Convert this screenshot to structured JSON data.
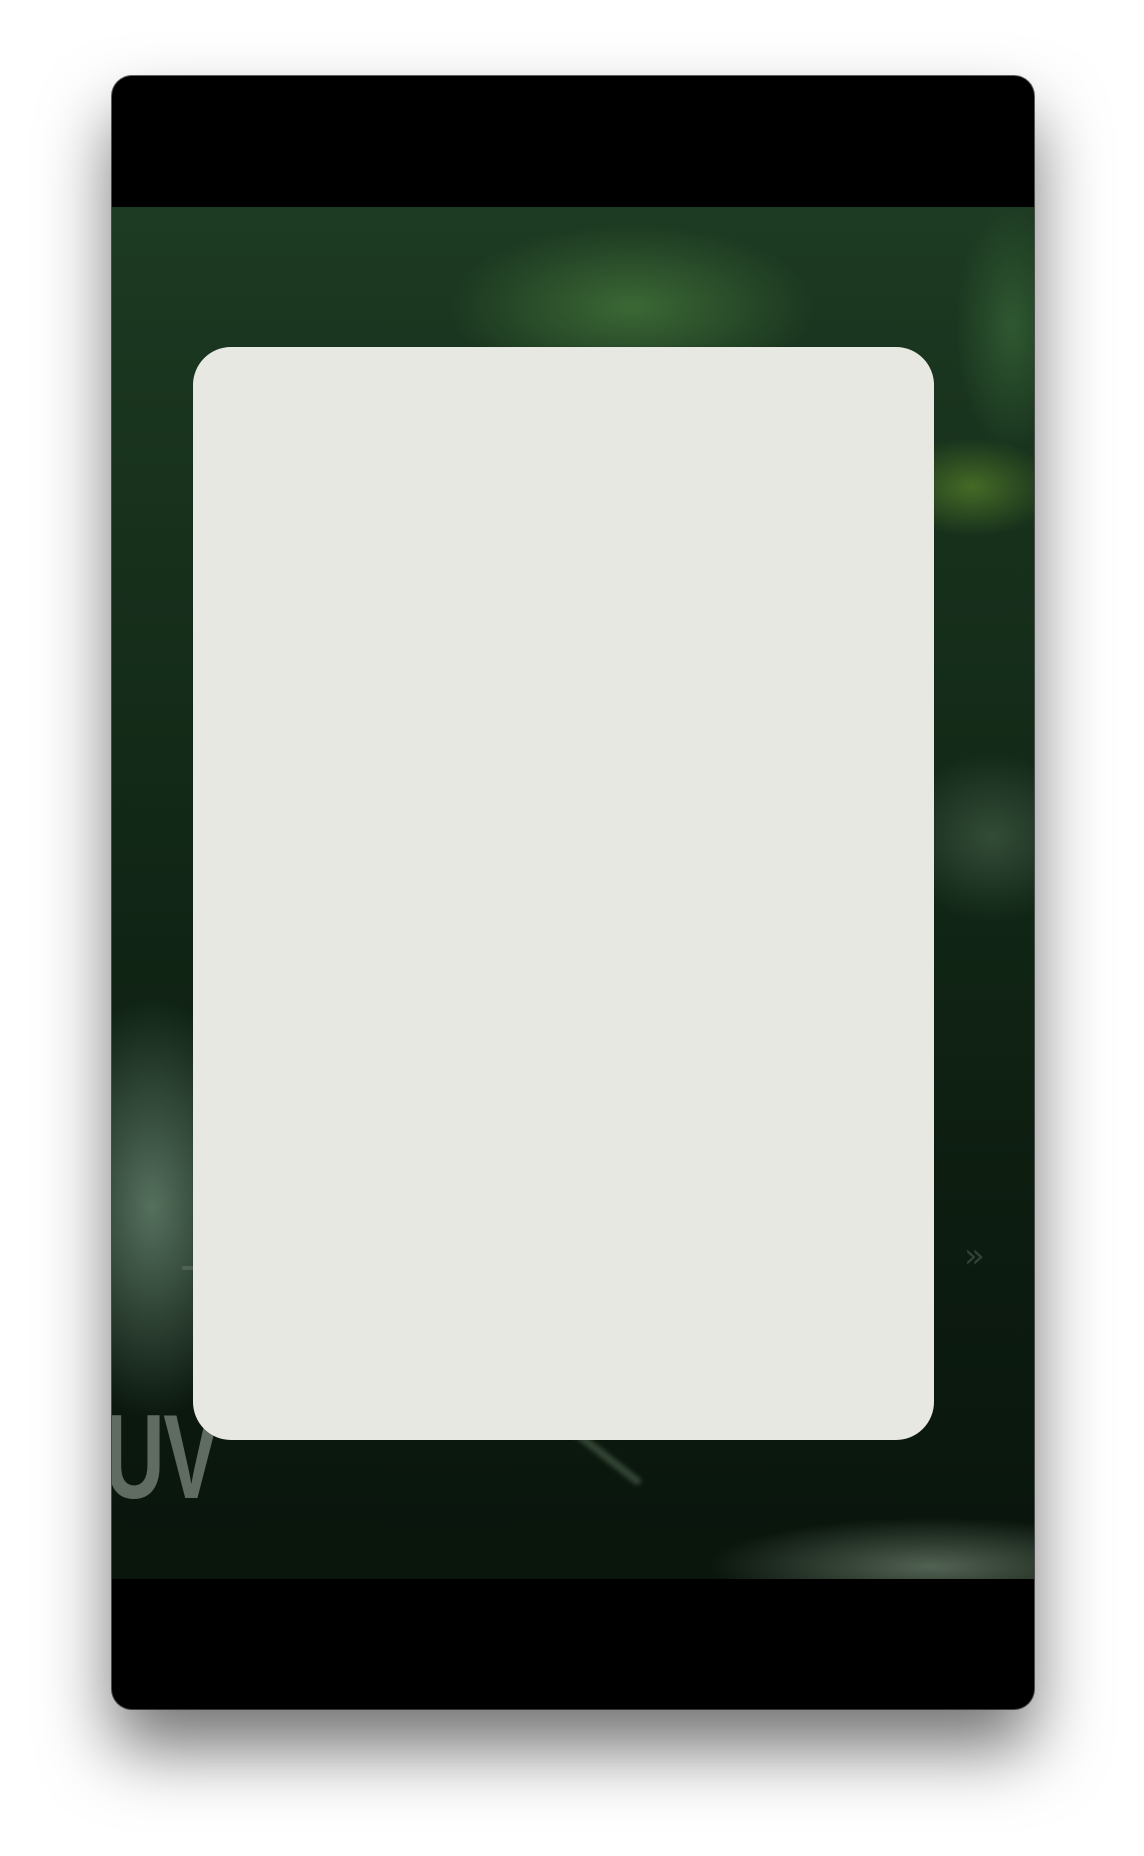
{
  "player": {
    "brand_text": "UV",
    "controls": {
      "rewind_icon": "rewind-icon",
      "play_icon": "play-icon",
      "fast_forward_icon": "fast-forward-icon",
      "pip_icon": "picture-in-picture-icon",
      "share_icon": "share-icon",
      "more_icon": "more-icon",
      "rewind_glyph": "◀◀",
      "play_glyph": "▶",
      "fast_forward_glyph": "▶▶",
      "more_glyph": "»"
    }
  },
  "colors": {
    "window_background": "#000000",
    "sheet_background": "#e8e8e3"
  }
}
